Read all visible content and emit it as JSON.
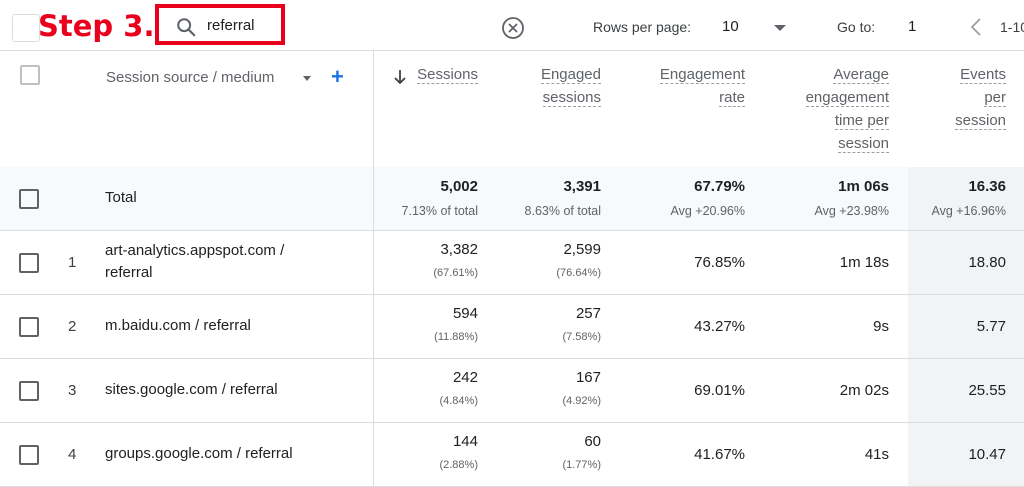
{
  "annotation": {
    "step_label": "Step 3."
  },
  "toolbar": {
    "search_value": "referral",
    "rows_per_page_label": "Rows per page:",
    "rows_per_page_value": "10",
    "goto_label": "Go to:",
    "goto_value": "1",
    "page_range": "1-10"
  },
  "table": {
    "dimension_header": "Session source / medium",
    "columns": {
      "sessions": [
        "Sessions"
      ],
      "engaged_sessions": [
        "Engaged",
        "sessions"
      ],
      "engagement_rate": [
        "Engagement",
        "rate"
      ],
      "avg_engagement_time": [
        "Average",
        "engagement",
        "time per",
        "session"
      ],
      "events_per_session": [
        "Events",
        "per",
        "session"
      ]
    },
    "total": {
      "label": "Total",
      "sessions": "5,002",
      "sessions_sub": "7.13% of total",
      "engaged_sessions": "3,391",
      "engaged_sessions_sub": "8.63% of total",
      "engagement_rate": "67.79%",
      "engagement_rate_sub": "Avg +20.96%",
      "avg_engagement_time": "1m 06s",
      "avg_engagement_time_sub": "Avg +23.98%",
      "events_per_session": "16.36",
      "events_per_session_sub": "Avg +16.96%"
    },
    "rows": [
      {
        "rank": "1",
        "dim_line1": "art-analytics.appspot.com /",
        "dim_line2": "referral",
        "sessions": "3,382",
        "sessions_pct": "(67.61%)",
        "engaged": "2,599",
        "engaged_pct": "(76.64%)",
        "rate": "76.85%",
        "time": "1m 18s",
        "events": "18.80"
      },
      {
        "rank": "2",
        "dim_line1": "m.baidu.com / referral",
        "dim_line2": "",
        "sessions": "594",
        "sessions_pct": "(11.88%)",
        "engaged": "257",
        "engaged_pct": "(7.58%)",
        "rate": "43.27%",
        "time": "9s",
        "events": "5.77"
      },
      {
        "rank": "3",
        "dim_line1": "sites.google.com / referral",
        "dim_line2": "",
        "sessions": "242",
        "sessions_pct": "(4.84%)",
        "engaged": "167",
        "engaged_pct": "(4.92%)",
        "rate": "69.01%",
        "time": "2m 02s",
        "events": "25.55"
      },
      {
        "rank": "4",
        "dim_line1": "groups.google.com / referral",
        "dim_line2": "",
        "sessions": "144",
        "sessions_pct": "(2.88%)",
        "engaged": "60",
        "engaged_pct": "(1.77%)",
        "rate": "41.67%",
        "time": "41s",
        "events": "10.47"
      }
    ]
  },
  "colors": {
    "annotation_red": "#e8001c",
    "accent_blue": "#1a73e8",
    "highlight_column": "#f1f3f4"
  },
  "icons": [
    "search-icon",
    "clear-icon",
    "chevron-down-icon",
    "chevron-left-icon",
    "sort-down-arrow-icon",
    "add-dimension-icon"
  ]
}
